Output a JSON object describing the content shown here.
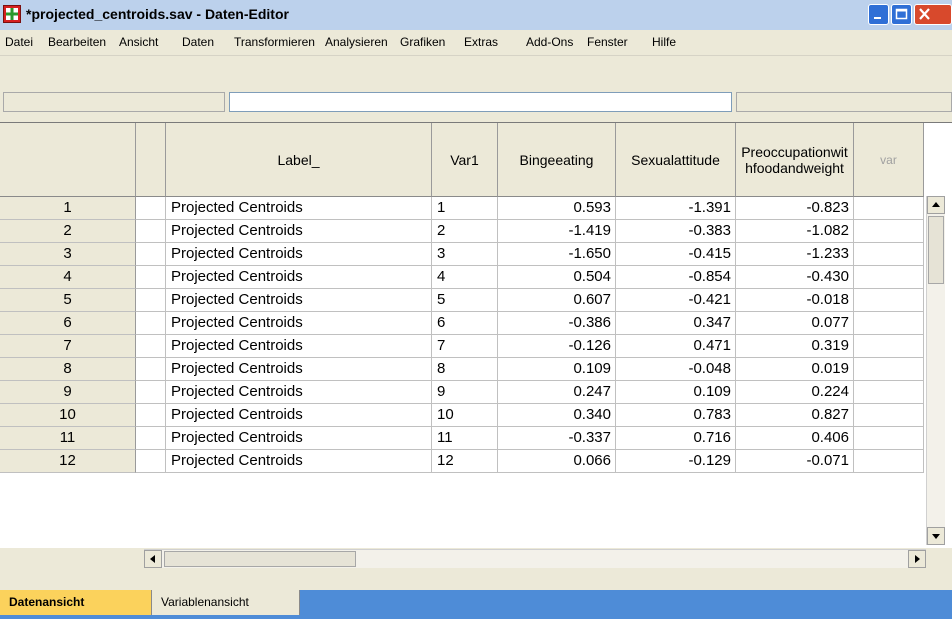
{
  "window": {
    "title": "*projected_centroids.sav - Daten-Editor",
    "icon": "spss-data-editor-icon",
    "controls": [
      "minimize-icon",
      "maximize-icon",
      "close-icon"
    ]
  },
  "menu": [
    "Datei",
    "Bearbeiten",
    "Ansicht",
    "Daten",
    "Transformieren",
    "Analysieren",
    "Grafiken",
    "Extras",
    "Add-Ons",
    "Fenster",
    "Hilfe"
  ],
  "cell_editor": {
    "reference": "",
    "value": ""
  },
  "grid": {
    "columns": [
      "",
      "",
      "Label_",
      "Var1",
      "Bingeeating",
      "Sexualattitude",
      "Preoccupationwithfoodandweight",
      "var"
    ],
    "rows": [
      {
        "num": "1",
        "label": "Projected Centroids",
        "var1": "1",
        "binge": "0.593",
        "sex": "-1.391",
        "preocc": "-0.823"
      },
      {
        "num": "2",
        "label": "Projected Centroids",
        "var1": "2",
        "binge": "-1.419",
        "sex": "-0.383",
        "preocc": "-1.082"
      },
      {
        "num": "3",
        "label": "Projected Centroids",
        "var1": "3",
        "binge": "-1.650",
        "sex": "-0.415",
        "preocc": "-1.233"
      },
      {
        "num": "4",
        "label": "Projected Centroids",
        "var1": "4",
        "binge": "0.504",
        "sex": "-0.854",
        "preocc": "-0.430"
      },
      {
        "num": "5",
        "label": "Projected Centroids",
        "var1": "5",
        "binge": "0.607",
        "sex": "-0.421",
        "preocc": "-0.018"
      },
      {
        "num": "6",
        "label": "Projected Centroids",
        "var1": "6",
        "binge": "-0.386",
        "sex": "0.347",
        "preocc": "0.077"
      },
      {
        "num": "7",
        "label": "Projected Centroids",
        "var1": "7",
        "binge": "-0.126",
        "sex": "0.471",
        "preocc": "0.319"
      },
      {
        "num": "8",
        "label": "Projected Centroids",
        "var1": "8",
        "binge": "0.109",
        "sex": "-0.048",
        "preocc": "0.019"
      },
      {
        "num": "9",
        "label": "Projected Centroids",
        "var1": "9",
        "binge": "0.247",
        "sex": "0.109",
        "preocc": "0.224"
      },
      {
        "num": "10",
        "label": "Projected Centroids",
        "var1": "10",
        "binge": "0.340",
        "sex": "0.783",
        "preocc": "0.827"
      },
      {
        "num": "11",
        "label": "Projected Centroids",
        "var1": "11",
        "binge": "-0.337",
        "sex": "0.716",
        "preocc": "0.406"
      },
      {
        "num": "12",
        "label": "Projected Centroids",
        "var1": "12",
        "binge": "0.066",
        "sex": "-0.129",
        "preocc": "-0.071"
      }
    ]
  },
  "tabs": [
    "Datenansicht",
    "Variablenansicht"
  ],
  "colors": {
    "title_bar": "#bcd1ec",
    "chrome": "#ece9d8",
    "active_tab": "#fbd25c",
    "tab_strip": "#4e8cd7",
    "close_button": "#d8492c"
  }
}
